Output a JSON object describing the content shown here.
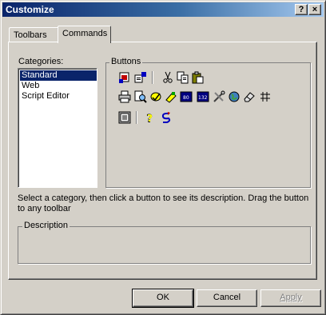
{
  "window": {
    "title": "Customize",
    "help_button": "?",
    "close_button": "×"
  },
  "tabs": [
    {
      "label": "Toolbars",
      "active": false
    },
    {
      "label": "Commands",
      "active": true
    }
  ],
  "categories": {
    "label": "Categories:",
    "items": [
      "Standard",
      "Web",
      "Script Editor"
    ],
    "selected": "Standard"
  },
  "buttons_group": {
    "label": "Buttons",
    "icons": [
      [
        "new-document-icon",
        "open-icon",
        "cut-icon",
        "copy-icon",
        "paste-icon"
      ],
      [
        "print-icon",
        "print-preview-icon",
        "spelling-icon",
        "format-painter-icon",
        "view-80-icon",
        "view-132-icon",
        "tools-icon",
        "globe-icon",
        "eraser-icon",
        "grid-icon"
      ],
      [
        "properties-icon",
        "help-icon",
        "undo-icon"
      ]
    ]
  },
  "hint_text": "Select a category, then click a button to see its description. Drag the button to any toolbar",
  "description": {
    "label": "Description",
    "text": ""
  },
  "footer": {
    "ok": "OK",
    "cancel": "Cancel",
    "apply": "Apply"
  },
  "colors": {
    "face": "#d4d0c8",
    "title_start": "#0a246a",
    "selection": "#0a246a"
  }
}
